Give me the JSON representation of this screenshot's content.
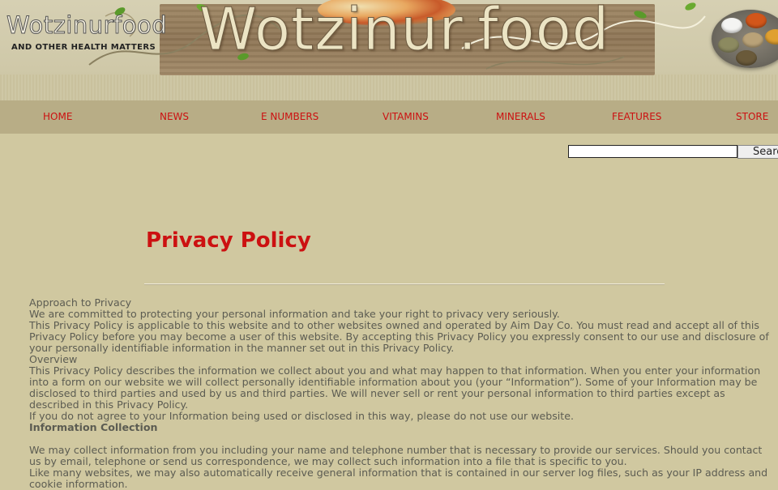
{
  "header": {
    "site_name_small": "Wotzinurfood",
    "tagline": "AND OTHER HEALTH MATTERS",
    "site_name_large": "Wotzinur.food"
  },
  "nav": {
    "items": [
      {
        "label": "HOME"
      },
      {
        "label": "NEWS"
      },
      {
        "label": "E NUMBERS"
      },
      {
        "label": "VITAMINS"
      },
      {
        "label": "MINERALS"
      },
      {
        "label": "FEATURES"
      },
      {
        "label": "STORE"
      }
    ]
  },
  "search": {
    "value": "",
    "button_label": "Search"
  },
  "page": {
    "title": "Privacy Policy"
  },
  "content": {
    "lines": [
      "Approach to Privacy",
      "We are committed to protecting your personal information and take your right to privacy very seriously.",
      "This Privacy Policy is applicable to this website and to other websites owned and operated by Aim Day Co. You must read and accept all of this",
      "Privacy Policy before you may become a user of this website. By accepting this Privacy Policy you expressly consent to our use and disclosure of",
      "your personally identifiable information in the manner set out in this Privacy Policy.",
      "Overview",
      "This Privacy Policy describes the information we collect about you and what may happen to that information. When you enter your information",
      "into a form on our website we will collect personally identifiable information about you (your “Information”). Some of your Information may be",
      "disclosed to third parties and used by us and third parties. We will never sell or rent your personal information to third parties except as",
      "described in this Privacy Policy.",
      "If you do not agree to your Information being used or disclosed in this way, please do not use our website."
    ],
    "section_heading": "Information Collection",
    "lines2": [
      "We may collect information from you including your name and telephone number that is necessary to provide our services. Should you contact",
      "us by email, telephone or send us correspondence, we may collect such information into a file that is specific to you.",
      "Like many websites, we may also automatically receive general information that is contained in our server log files, such as your IP address and",
      "cookie information."
    ]
  },
  "colors": {
    "background": "#d0c8a0",
    "nav_background": "#b8ad86",
    "link_red": "#cc1111",
    "body_text": "#5c5c52"
  }
}
